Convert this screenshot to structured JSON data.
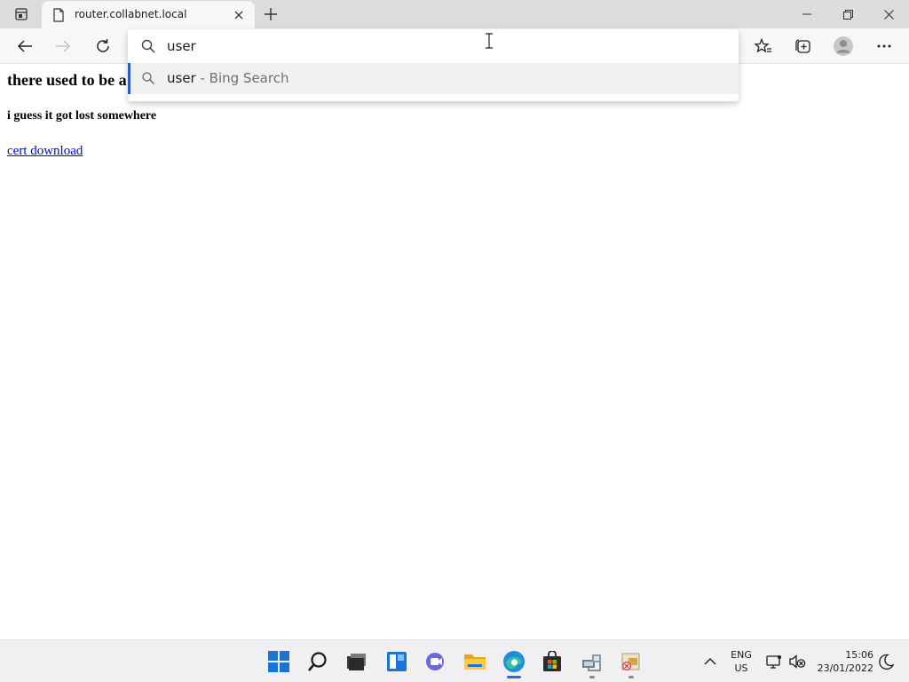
{
  "browser": {
    "tab": {
      "title": "router.collabnet.local"
    },
    "address_bar": {
      "value": "user"
    },
    "suggestions": [
      {
        "query": "user",
        "suffix": " - Bing Search"
      }
    ]
  },
  "page": {
    "heading": "there used to be a",
    "subheading": "i guess it got lost somewhere",
    "link": "cert download"
  },
  "taskbar": {
    "apps": [
      "start-icon",
      "search-icon",
      "task-view-icon",
      "widgets-icon",
      "chat-icon",
      "file-explorer-icon",
      "edge-icon",
      "store-icon",
      "network-app-icon",
      "blocked-app-icon"
    ],
    "language": {
      "line1": "ENG",
      "line2": "US"
    },
    "clock": {
      "time": "15:06",
      "date": "23/01/2022"
    }
  },
  "colors": {
    "accent": "#2e5fbe",
    "link": "#0000ee",
    "tabstrip": "#dcdcdc",
    "toolbar": "#f7f7f7",
    "taskbar": "#f0f0f2"
  }
}
